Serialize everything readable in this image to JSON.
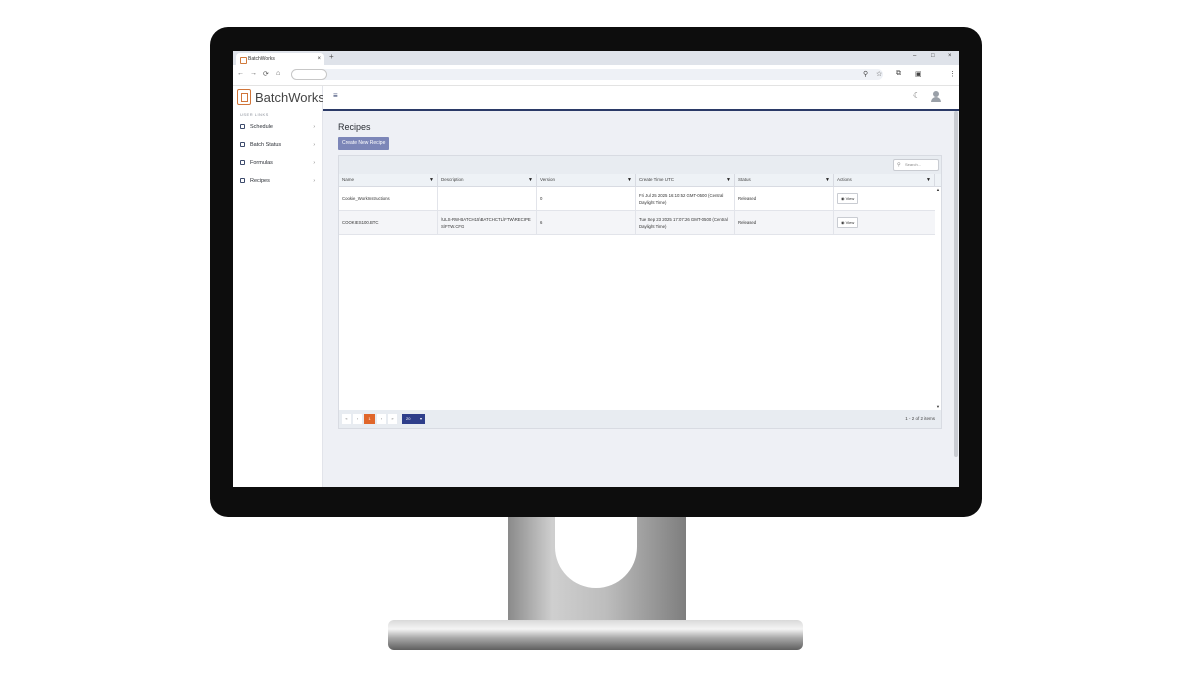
{
  "browser": {
    "tab_title": "BatchWorks",
    "tab_close": "×",
    "new_tab": "+",
    "win_min": "–",
    "win_max": "□",
    "win_close": "×",
    "back": "←",
    "forward": "→",
    "reload": "⟳",
    "home": "⌂",
    "icons": [
      "search-icon",
      "star-icon",
      "extensions-icon",
      "sidebar-icon",
      "menu-icon"
    ]
  },
  "app": {
    "brand": "BatchWorks",
    "sidebar": {
      "section_title": "USER LINKS",
      "items": [
        {
          "label": "Schedule",
          "icon": "cube-icon"
        },
        {
          "label": "Batch Status",
          "icon": "grid-icon"
        },
        {
          "label": "Formulas",
          "icon": "clipboard-icon"
        },
        {
          "label": "Recipes",
          "icon": "clipboard-icon"
        }
      ],
      "chevron": "›"
    },
    "topbar": {
      "menu": "≡",
      "theme": "☾"
    },
    "page": {
      "title": "Recipes",
      "create_button": "Create New Recipe",
      "search_placeholder": "Search..."
    },
    "grid": {
      "columns": [
        "Name",
        "Description",
        "Version",
        "Create Time UTC",
        "Status",
        "Actions"
      ],
      "rows": [
        {
          "name": "Cookie_WorkInstructions",
          "description": "",
          "version": "0",
          "create_time": "Fri Jul 25 2025 16:10:52 GMT-0500 (Central Daylight Time)",
          "status": "Released",
          "action": "View"
        },
        {
          "name": "COOKIES100.BTC",
          "description": "\\ULS-RW-BATCH15\\BATCHCTL\\FTW\\RECIPES\\FTW.CFG",
          "version": "6",
          "create_time": "Tue Sep 23 2025 17:07:26 GMT-0500 (Central Daylight Time)",
          "status": "Released",
          "action": "View"
        }
      ],
      "pager": {
        "first": "«",
        "prev": "‹",
        "current_page": "1",
        "next": "›",
        "last": "»",
        "page_size": "20",
        "summary": "1 - 2 of 2 items"
      }
    },
    "colors": {
      "accent": "#2b3a67",
      "brand_orange": "#d0753a",
      "button": "#7c86b8",
      "pager_current": "#e0662a",
      "page_size": "#2e3e8a"
    }
  }
}
